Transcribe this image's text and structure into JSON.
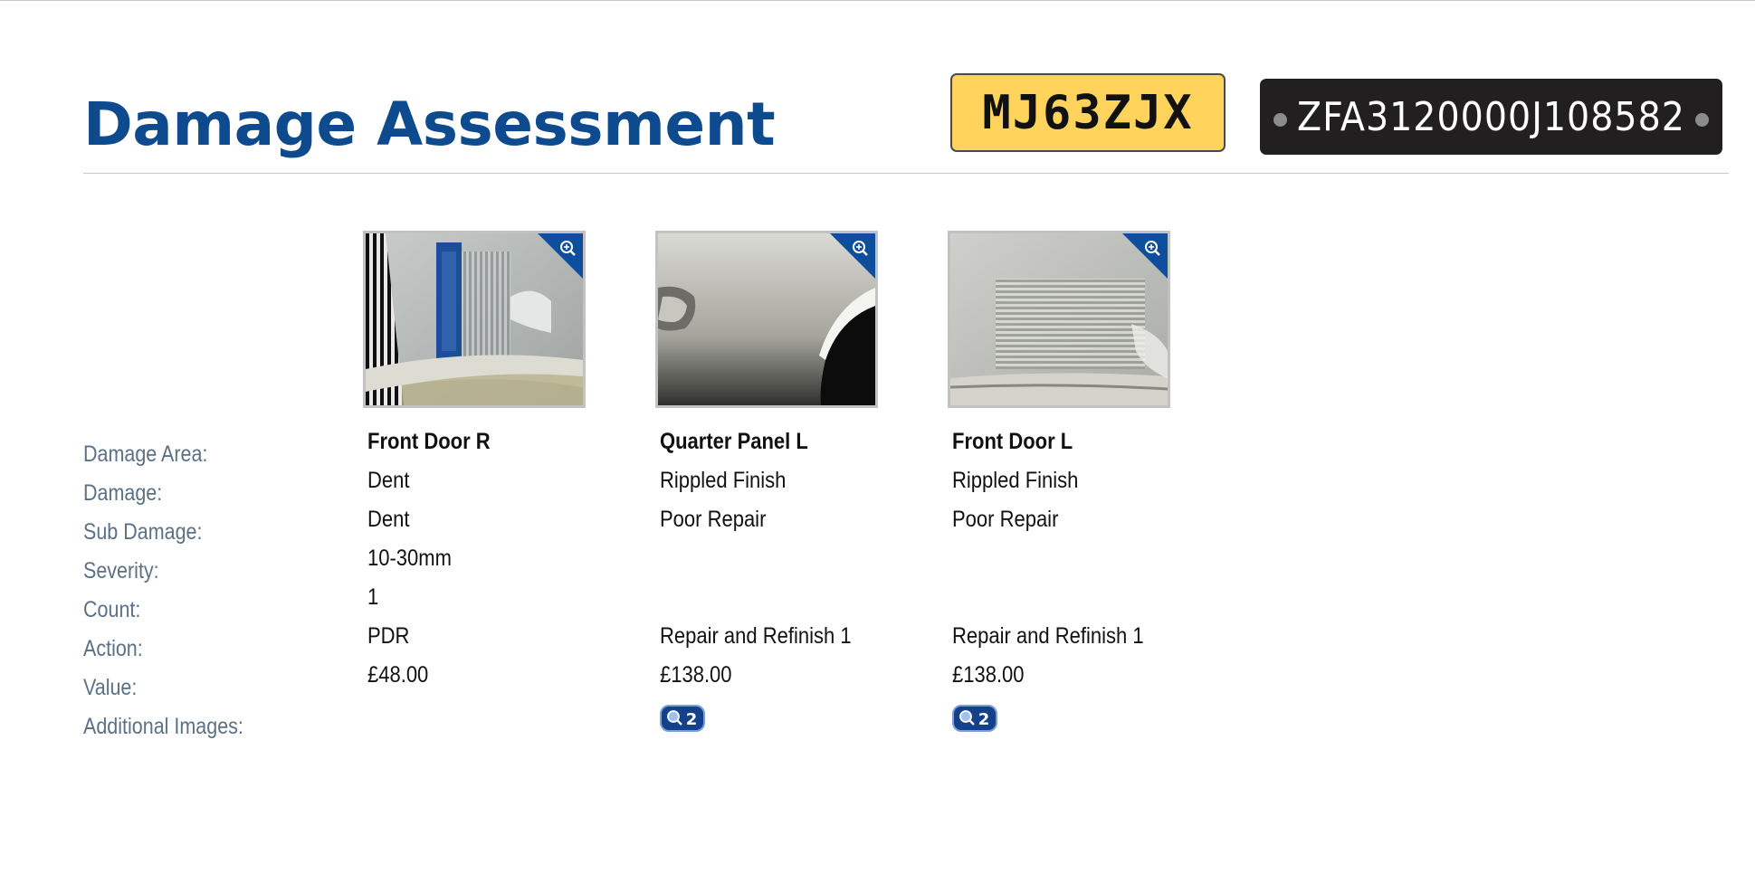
{
  "header": {
    "title": "Damage Assessment",
    "registration": "MJ63ZJX",
    "vin": "ZFA3120000J108582"
  },
  "labels": {
    "damage_area": "Damage Area:",
    "damage": "Damage:",
    "sub_damage": "Sub Damage:",
    "severity": "Severity:",
    "count": "Count:",
    "action": "Action:",
    "value": "Value:",
    "additional_images": "Additional Images:"
  },
  "items": [
    {
      "damage_area": "Front Door R",
      "damage": "Dent",
      "sub_damage": "Dent",
      "severity": "10-30mm",
      "count": "1",
      "action": "PDR",
      "value": "£48.00",
      "additional_images": ""
    },
    {
      "damage_area": "Quarter Panel L",
      "damage": "Rippled Finish",
      "sub_damage": "Poor Repair",
      "severity": "",
      "count": "",
      "action": "Repair and Refinish 1",
      "value": "£138.00",
      "additional_images": "2"
    },
    {
      "damage_area": "Front Door L",
      "damage": "Rippled Finish",
      "sub_damage": "Poor Repair",
      "severity": "",
      "count": "",
      "action": "Repair and Refinish 1",
      "value": "£138.00",
      "additional_images": "2"
    }
  ],
  "icons": {
    "thumbnail_zoom": "zoom-in-icon",
    "additional_images": "magnifier-count-icon"
  },
  "colors": {
    "title": "#0e4a8e",
    "label": "#5b7186",
    "plate_yellow": "#ffd35c",
    "vin_plate": "#221f20",
    "zoom_corner": "#0d4f9c"
  }
}
